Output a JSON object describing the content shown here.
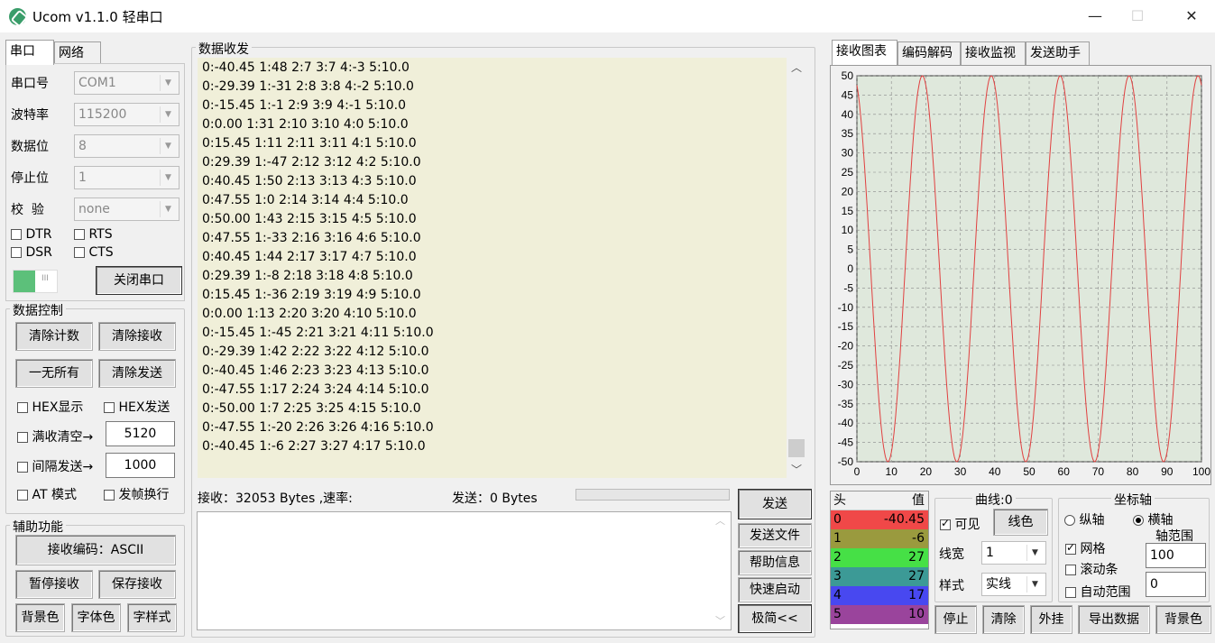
{
  "window": {
    "title": "Ucom v1.1.0 轻串口",
    "minimize": "—",
    "maximize": "☐",
    "close": "✕"
  },
  "left_tabs": [
    "串口",
    "网络"
  ],
  "serial": {
    "port_label": "串口号",
    "port_value": "COM1",
    "baud_label": "波特率",
    "baud_value": "115200",
    "databits_label": "数据位",
    "databits_value": "8",
    "stopbits_label": "停止位",
    "stopbits_value": "1",
    "parity_label": "校  验",
    "parity_value": "none",
    "dtr": "DTR",
    "rts": "RTS",
    "dsr": "DSR",
    "cts": "CTS",
    "close_port": "关闭串口",
    "toggle_state": "on"
  },
  "data_control": {
    "title": "数据控制",
    "clear_count": "清除计数",
    "clear_recv": "清除接收",
    "clear_all": "一无所有",
    "clear_send": "清除发送",
    "hex_display": "HEX显示",
    "hex_send": "HEX发送",
    "full_clear": "满收清空→",
    "full_clear_value": "5120",
    "interval_send": "间隔发送→",
    "interval_value": "1000",
    "at_mode": "AT 模式",
    "frame_newline": "发帧换行"
  },
  "aux": {
    "title": "辅助功能",
    "recv_encoding": "接收编码：ASCII",
    "pause_recv": "暂停接收",
    "save_recv": "保存接收",
    "bg_color": "背景色",
    "font_color": "字体色",
    "font_style": "字样式"
  },
  "center": {
    "title": "数据收发",
    "lines": [
      "0:-40.45 1:48 2:7 3:7 4:-3 5:10.0",
      "0:-29.39 1:-31 2:8 3:8 4:-2 5:10.0",
      "0:-15.45 1:-1 2:9 3:9 4:-1 5:10.0",
      "0:0.00 1:31 2:10 3:10 4:0 5:10.0",
      "0:15.45 1:11 2:11 3:11 4:1 5:10.0",
      "0:29.39 1:-47 2:12 3:12 4:2 5:10.0",
      "0:40.45 1:50 2:13 3:13 4:3 5:10.0",
      "0:47.55 1:0 2:14 3:14 4:4 5:10.0",
      "0:50.00 1:43 2:15 3:15 4:5 5:10.0",
      "0:47.55 1:-33 2:16 3:16 4:6 5:10.0",
      "0:40.45 1:44 2:17 3:17 4:7 5:10.0",
      "0:29.39 1:-8 2:18 3:18 4:8 5:10.0",
      "0:15.45 1:-36 2:19 3:19 4:9 5:10.0",
      "0:0.00 1:13 2:20 3:20 4:10 5:10.0",
      "0:-15.45 1:-45 2:21 3:21 4:11 5:10.0",
      "0:-29.39 1:42 2:22 3:22 4:12 5:10.0",
      "0:-40.45 1:46 2:23 3:23 4:13 5:10.0",
      "0:-47.55 1:17 2:24 3:24 4:14 5:10.0",
      "0:-50.00 1:7 2:25 3:25 4:15 5:10.0",
      "0:-47.55 1:-20 2:26 3:26 4:16 5:10.0",
      "0:-40.45 1:-6 2:27 3:27 4:17 5:10.0"
    ],
    "recv_status": "接收：32053 Bytes ,速率:",
    "send_status": "发送：0 Bytes",
    "send_text": "",
    "send_btn": "发送",
    "send_file": "发送文件",
    "help": "帮助信息",
    "quick_start": "快速启动",
    "simple": "极简<<"
  },
  "right_tabs": [
    "接收图表",
    "编码解码",
    "接收监视",
    "发送助手"
  ],
  "chart_data": {
    "type": "line",
    "x_ticks": [
      0,
      10,
      20,
      30,
      40,
      50,
      60,
      70,
      80,
      90,
      100
    ],
    "y_ticks": [
      50,
      45,
      40,
      35,
      30,
      25,
      20,
      15,
      10,
      5,
      0,
      -5,
      -10,
      -15,
      -20,
      -25,
      -30,
      -35,
      -40,
      -45,
      -50
    ],
    "xlim": [
      0,
      100
    ],
    "ylim": [
      -50,
      50
    ],
    "grid": true,
    "series": [
      {
        "color": "#e04040",
        "x": [
          0,
          1,
          2,
          3,
          4,
          5,
          6,
          7,
          8,
          9,
          10,
          11,
          12,
          13,
          14,
          15,
          16,
          17,
          18,
          19,
          20,
          21,
          22,
          23,
          24,
          25,
          26,
          27,
          28,
          29,
          30,
          31,
          32,
          33,
          34,
          35,
          36,
          37,
          38,
          39,
          40,
          41,
          42,
          43,
          44,
          45,
          46,
          47,
          48,
          49,
          50,
          51,
          52,
          53,
          54,
          55,
          56,
          57,
          58,
          59,
          60,
          61,
          62,
          63,
          64,
          65,
          66,
          67,
          68,
          69,
          70,
          71,
          72,
          73,
          74,
          75,
          76,
          77,
          78,
          79,
          80,
          81,
          82,
          83,
          84,
          85,
          86,
          87,
          88,
          89,
          90,
          91,
          92,
          93,
          94,
          95,
          96,
          97,
          98,
          99,
          100
        ],
        "y": [
          47.55,
          40.45,
          29.39,
          15.45,
          0.0,
          -15.45,
          -29.39,
          -40.45,
          -47.55,
          -50.0,
          -47.55,
          -40.45,
          -29.39,
          -15.45,
          0.0,
          15.45,
          29.39,
          40.45,
          47.55,
          50.0,
          47.55,
          40.45,
          29.39,
          15.45,
          0.0,
          -15.45,
          -29.39,
          -40.45,
          -47.55,
          -50.0,
          -47.55,
          -40.45,
          -29.39,
          -15.45,
          0.0,
          15.45,
          29.39,
          40.45,
          47.55,
          50.0,
          47.55,
          40.45,
          29.39,
          15.45,
          0.0,
          -15.45,
          -29.39,
          -40.45,
          -47.55,
          -50.0,
          -47.55,
          -40.45,
          -29.39,
          -15.45,
          0.0,
          15.45,
          29.39,
          40.45,
          47.55,
          50.0,
          47.55,
          40.45,
          29.39,
          15.45,
          0.0,
          -15.45,
          -29.39,
          -40.45,
          -47.55,
          -50.0,
          -47.55,
          -40.45,
          -29.39,
          -15.45,
          0.0,
          15.45,
          29.39,
          40.45,
          47.55,
          50.0,
          47.55,
          40.45,
          29.39,
          15.45,
          0.0,
          -15.45,
          -29.39,
          -40.45,
          -47.55,
          -50.0,
          -47.55,
          -40.45,
          -29.39,
          -15.45,
          0.0,
          15.45,
          29.39,
          40.45,
          47.55,
          50.0,
          47.55
        ]
      }
    ]
  },
  "value_table": {
    "head_col": "头",
    "value_col": "值",
    "rows": [
      {
        "head": "0",
        "value": "-40.45",
        "color": "#f04848"
      },
      {
        "head": "1",
        "value": "-6",
        "color": "#9a9a3e"
      },
      {
        "head": "2",
        "value": "27",
        "color": "#46e046"
      },
      {
        "head": "3",
        "value": "27",
        "color": "#3c9a96"
      },
      {
        "head": "4",
        "value": "17",
        "color": "#4848f0"
      },
      {
        "head": "5",
        "value": "10",
        "color": "#9a449c"
      }
    ]
  },
  "curve": {
    "title": "曲线:0",
    "visible": "可见",
    "line_color": "线色",
    "width_label": "线宽",
    "width_value": "1",
    "style_label": "样式",
    "style_value": "实线"
  },
  "axis": {
    "title": "坐标轴",
    "vertical": "纵轴",
    "horizontal": "横轴",
    "range_label": "轴范围",
    "range_value": "100",
    "grid": "网格",
    "scrollbar": "滚动条",
    "auto_range": "自动范围",
    "offset_value": "0"
  },
  "bottom_buttons": {
    "stop": "停止",
    "clear": "清除",
    "external": "外挂",
    "export": "导出数据",
    "bg": "背景色"
  }
}
